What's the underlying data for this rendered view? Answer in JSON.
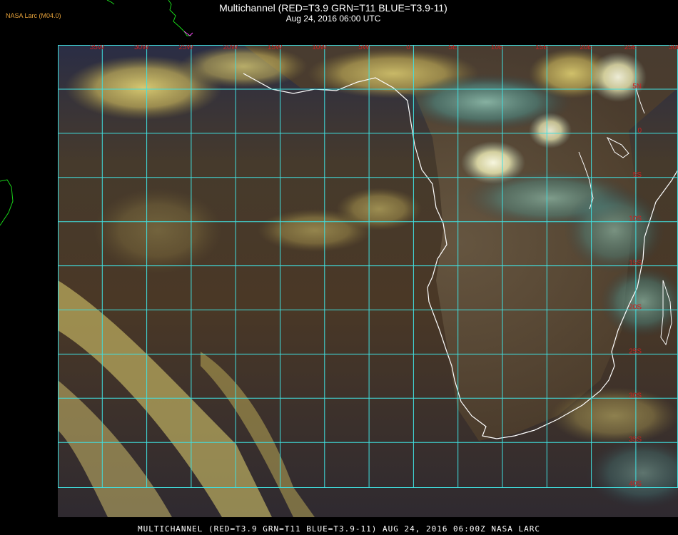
{
  "header": {
    "agency": "NASA Larc (M04.0)",
    "title": "Multichannel (RED=T3.9 GRN=T11 BLUE=T3.9-11)",
    "datetime": "Aug 24, 2016 06:00 UTC"
  },
  "footer": {
    "caption": "MULTICHANNEL (RED=T3.9 GRN=T11 BLUE=T3.9-11) AUG 24, 2016 06:00Z   NASA LARC"
  },
  "map": {
    "grid_color": "#40e0e0",
    "label_color": "#cc2020",
    "coast_color": "#ffffff",
    "lon_labels": [
      "35W",
      "30W",
      "25W",
      "20W",
      "15W",
      "10W",
      "5W",
      "0",
      "5E",
      "10E",
      "15E",
      "20E",
      "25E",
      "30E",
      "35E"
    ],
    "lat_labels": [
      "5N",
      "0",
      "5S",
      "10S",
      "15S",
      "20S",
      "25S",
      "30S",
      "35S",
      "40S"
    ]
  }
}
